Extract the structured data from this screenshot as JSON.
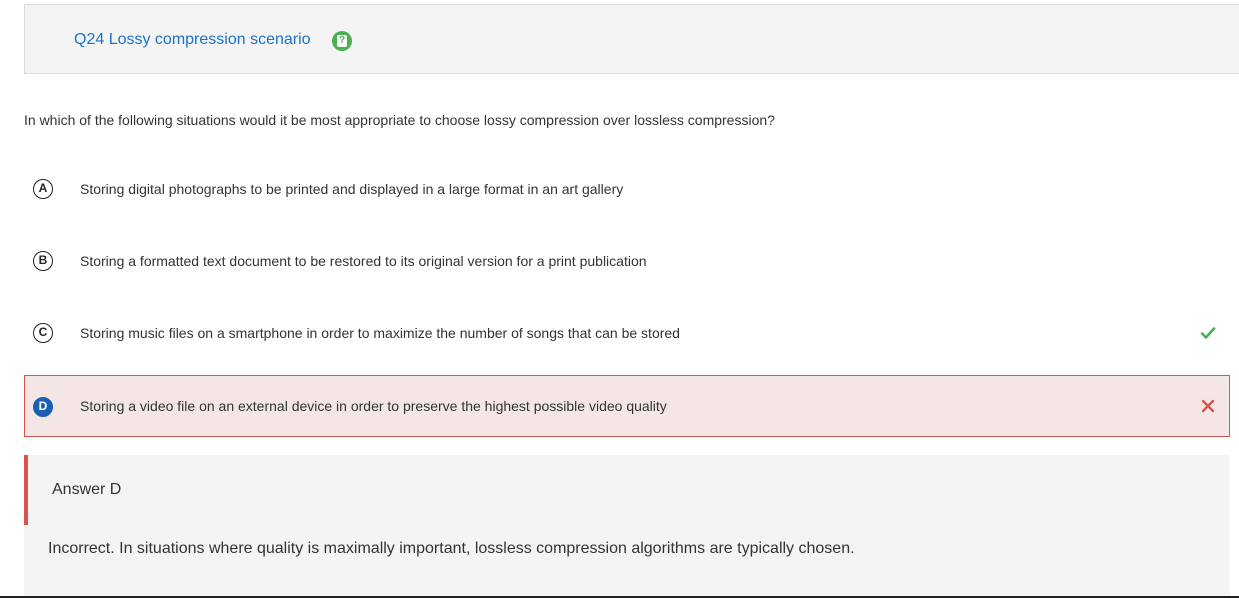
{
  "question": {
    "title": "Q24 Lossy compression scenario",
    "help_icon": "help-question-icon",
    "text": "In which of the following situations would it be most appropriate to choose lossy compression over lossless compression?"
  },
  "options": [
    {
      "letter": "A",
      "text": "Storing digital photographs to be printed and displayed in a large format in an art gallery",
      "state": "none"
    },
    {
      "letter": "B",
      "text": "Storing a formatted text document to be restored to its original version for a print publication",
      "state": "none"
    },
    {
      "letter": "C",
      "text": "Storing music files on a smartphone in order to maximize the number of songs that can be stored",
      "state": "correct"
    },
    {
      "letter": "D",
      "text": "Storing a video file on an external device in order to preserve the highest possible video quality",
      "state": "selected-incorrect"
    }
  ],
  "feedback": {
    "answer_label": "Answer D",
    "explanation": "Incorrect. In situations where quality is maximally important, lossless compression algorithms are typically chosen."
  },
  "colors": {
    "link_blue": "#1a73c7",
    "help_green": "#4caf50",
    "correct_green": "#4caf50",
    "incorrect_red": "#d9534f",
    "selected_blue": "#1a5fb4",
    "panel_gray": "#f4f4f4",
    "selected_bg": "#f5e6e6"
  }
}
